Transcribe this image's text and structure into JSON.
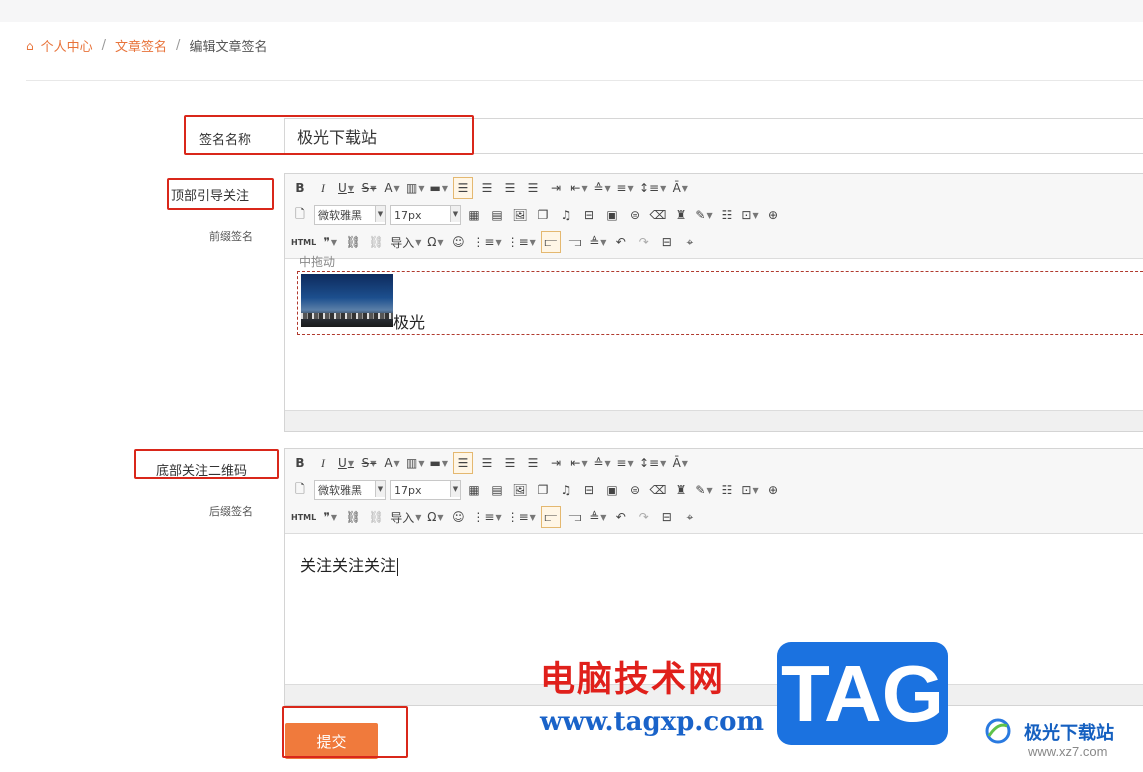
{
  "breadcrumb": {
    "home": "个人中心",
    "section": "文章签名",
    "current": "编辑文章签名",
    "separator": "/"
  },
  "form": {
    "name_label": "签名名称",
    "name_value": "极光下载站",
    "top_label": "顶部引导关注",
    "top_sublabel": "前缀签名",
    "bottom_label": "底部关注二维码",
    "bottom_sublabel": "后缀签名",
    "submit_label": "提交"
  },
  "toolbar": {
    "font_family": "微软雅黑",
    "font_size": "17px",
    "html_label": "HTML",
    "import_label": "导入"
  },
  "top_editor": {
    "drag_hint": "中拖动",
    "image_caption": "极光"
  },
  "bottom_editor": {
    "text": "关注关注关注"
  },
  "watermark": {
    "brand_cn": "电脑技术网",
    "url": "www.tagxp.com",
    "tag": "TAG",
    "site_name": "极光下载站",
    "site_url": "www.xz7.com"
  },
  "colors": {
    "accent": "#e8733a",
    "highlight_border": "#d9271a",
    "submit_bg": "#f07a3c"
  }
}
